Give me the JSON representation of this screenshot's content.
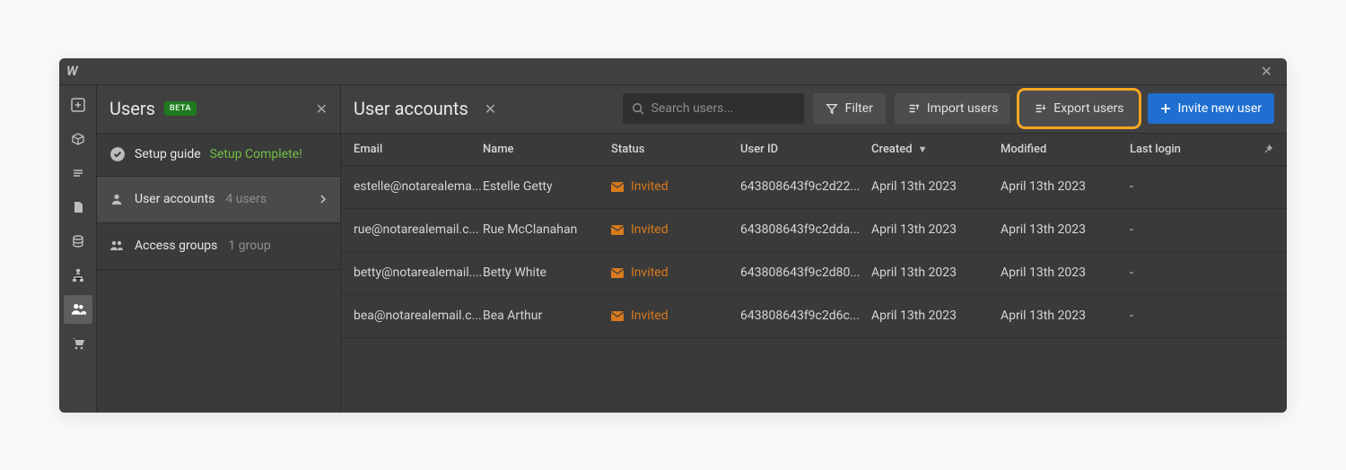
{
  "panel": {
    "title": "Users",
    "badge": "BETA",
    "setup_label": "Setup guide",
    "setup_status": "Setup Complete!",
    "nav": [
      {
        "label": "User accounts",
        "count": "4 users"
      },
      {
        "label": "Access groups",
        "count": "1 group"
      }
    ]
  },
  "toolbar": {
    "title": "User accounts",
    "search_placeholder": "Search users...",
    "filter": "Filter",
    "import": "Import users",
    "export": "Export users",
    "invite": "Invite new user"
  },
  "columns": {
    "email": "Email",
    "name": "Name",
    "status": "Status",
    "user_id": "User ID",
    "created": "Created",
    "modified": "Modified",
    "last_login": "Last login"
  },
  "rows": [
    {
      "email": "estelle@notarealema...",
      "name": "Estelle Getty",
      "status": "Invited",
      "user_id": "643808643f9c2d22...",
      "created": "April 13th 2023",
      "modified": "April 13th 2023",
      "last_login": "-"
    },
    {
      "email": "rue@notarealemail.c...",
      "name": "Rue McClanahan",
      "status": "Invited",
      "user_id": "643808643f9c2dda...",
      "created": "April 13th 2023",
      "modified": "April 13th 2023",
      "last_login": "-"
    },
    {
      "email": "betty@notarealemail....",
      "name": "Betty White",
      "status": "Invited",
      "user_id": "643808643f9c2d80...",
      "created": "April 13th 2023",
      "modified": "April 13th 2023",
      "last_login": "-"
    },
    {
      "email": "bea@notarealemail.c...",
      "name": "Bea Arthur",
      "status": "Invited",
      "user_id": "643808643f9c2d6c...",
      "created": "April 13th 2023",
      "modified": "April 13th 2023",
      "last_login": "-"
    }
  ]
}
